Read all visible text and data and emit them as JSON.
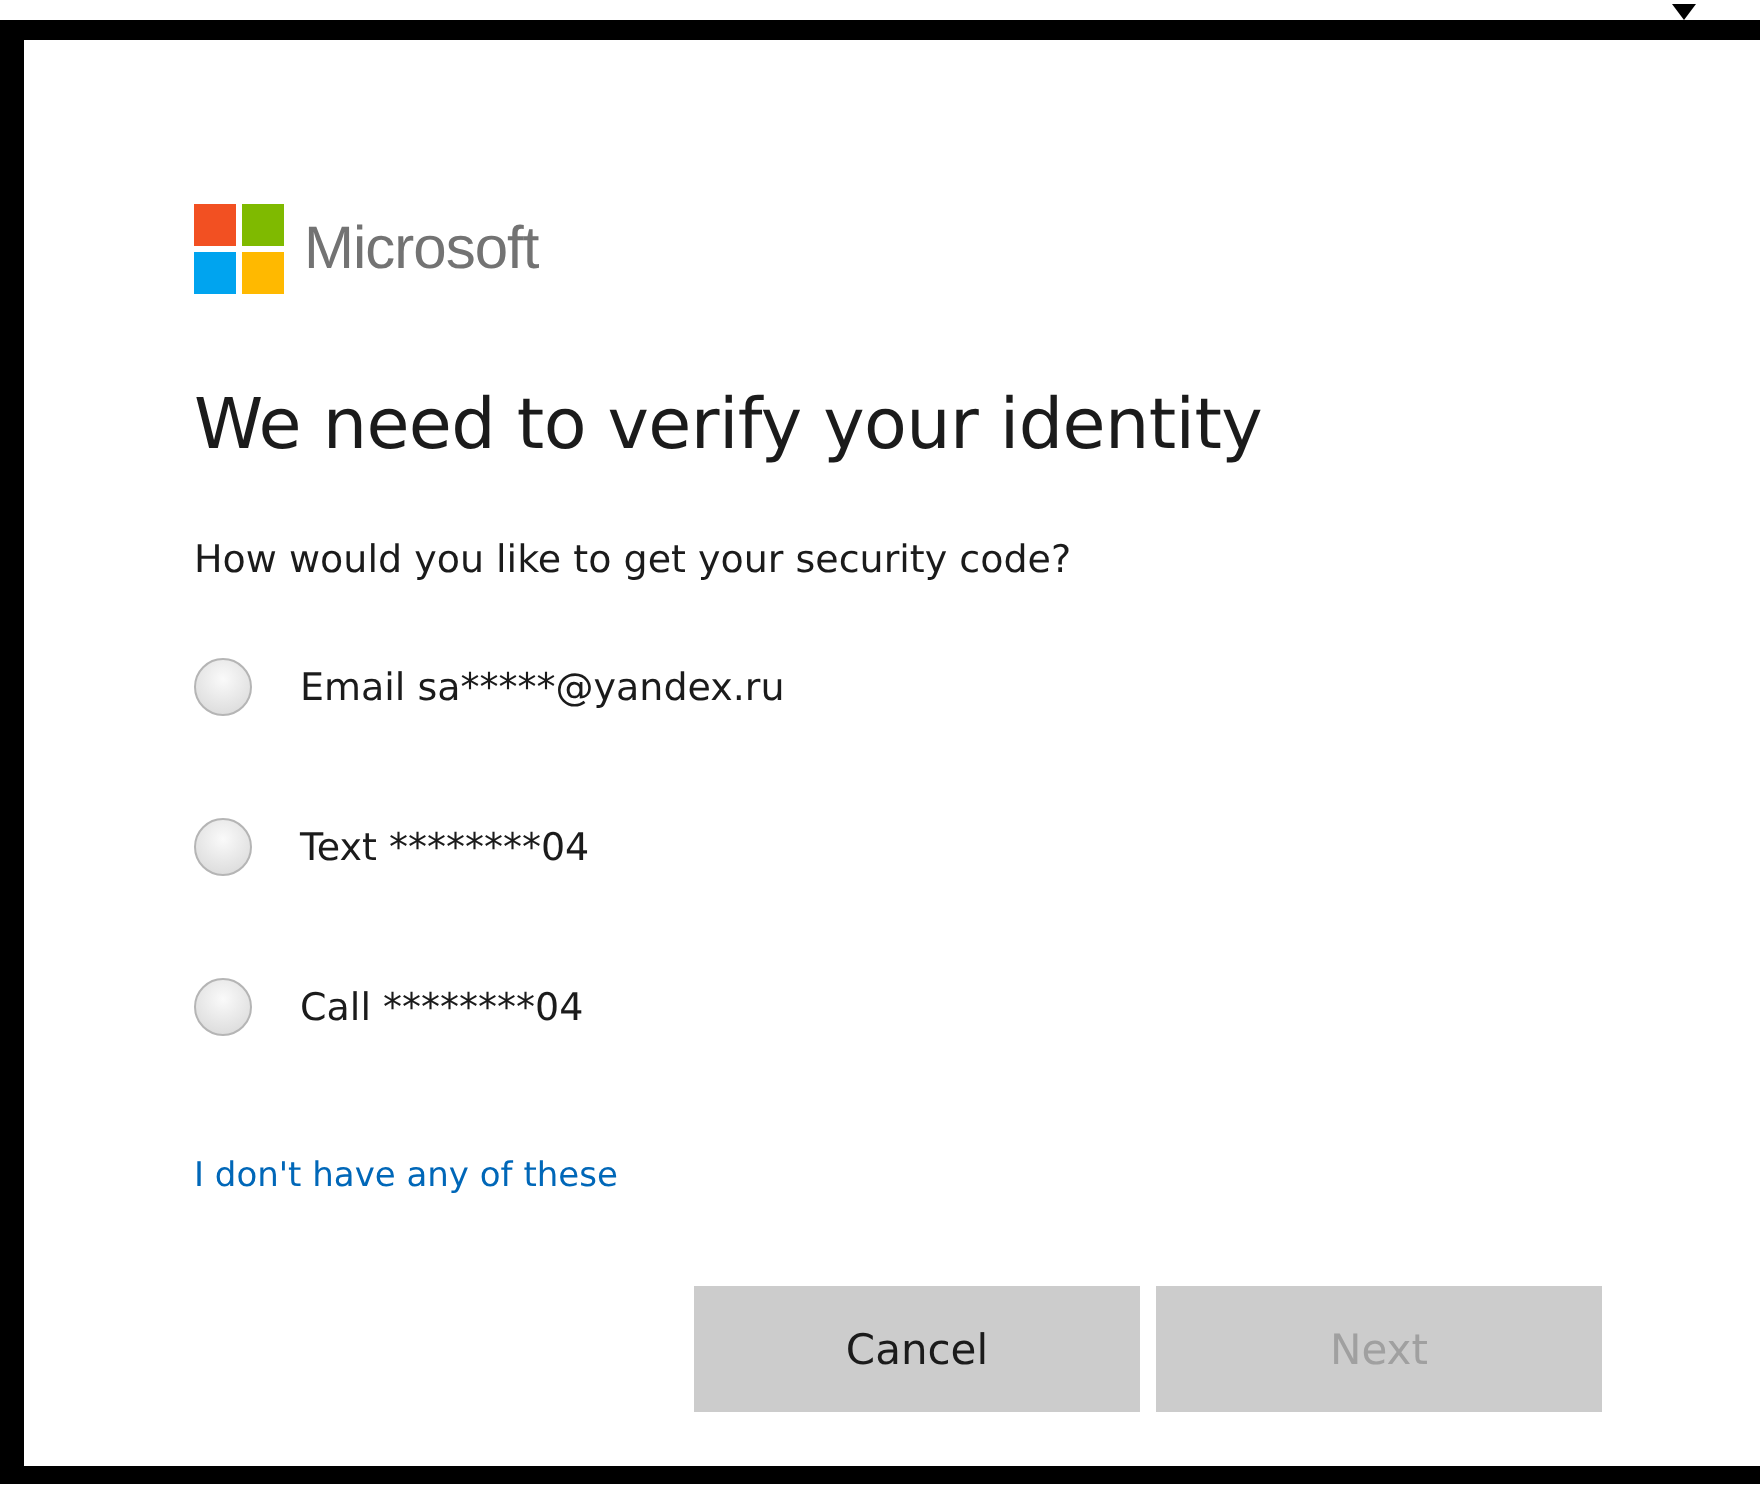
{
  "brand": {
    "name": "Microsoft"
  },
  "title": "We need to verify your identity",
  "prompt": "How would you like to get your security code?",
  "options": [
    {
      "label": "Email sa*****@yandex.ru",
      "selected": false
    },
    {
      "label": "Text ********04",
      "selected": false
    },
    {
      "label": "Call ********04",
      "selected": false
    }
  ],
  "link": "I don't have any of these",
  "buttons": [
    {
      "label": "Cancel",
      "disabled": false
    },
    {
      "label": "Next",
      "disabled": true
    }
  ]
}
